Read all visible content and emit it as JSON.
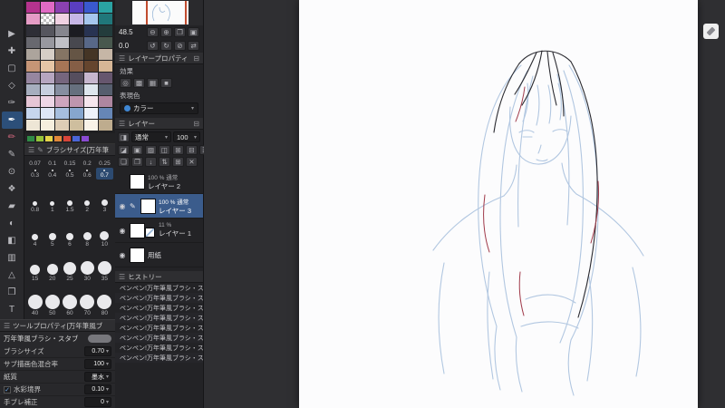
{
  "icons": {
    "menu": "☰",
    "collapse": "⊟",
    "pen": "✎",
    "eye": "◉",
    "check": "✓",
    "dropdown": "▾"
  },
  "toolbar": {
    "tools": [
      {
        "name": "operate-tool",
        "glyph": "▶"
      },
      {
        "name": "move-layer-tool",
        "glyph": "✚"
      },
      {
        "name": "selection-tool",
        "glyph": "▢"
      },
      {
        "name": "auto-select-tool",
        "glyph": "◇"
      },
      {
        "name": "eyedropper-tool",
        "glyph": "✑"
      },
      {
        "name": "pen-tool",
        "glyph": "✒",
        "selected": true
      },
      {
        "name": "pencil-tool",
        "glyph": "✏",
        "accent": true
      },
      {
        "name": "brush-tool",
        "glyph": "✎"
      },
      {
        "name": "airbrush-tool",
        "glyph": "⊙"
      },
      {
        "name": "decoration-tool",
        "glyph": "❖"
      },
      {
        "name": "eraser-tool",
        "glyph": "▰"
      },
      {
        "name": "blend-tool",
        "glyph": "◐"
      },
      {
        "name": "fill-tool",
        "glyph": "◧"
      },
      {
        "name": "gradient-tool",
        "glyph": "▥"
      },
      {
        "name": "figure-tool",
        "glyph": "△"
      },
      {
        "name": "frame-border-tool",
        "glyph": "❒"
      },
      {
        "name": "text-tool",
        "glyph": "T"
      }
    ]
  },
  "palette": {
    "colors": [
      "#b5338e",
      "#e06ac4",
      "#8a41b0",
      "#5a3ec0",
      "#3a59cf",
      "#2aa3a3",
      "#e59cc6",
      "checker",
      "#f0d2e2",
      "#c6b6e6",
      "#a5c6ee",
      "#20777a",
      "#2e2e36",
      "#56565e",
      "#86868e",
      "#1c1c22",
      "#283352",
      "#233c3c",
      "#68686f",
      "#98989f",
      "#c0c0c6",
      "#48484f",
      "#586888",
      "#48584e",
      "#aca49c",
      "#d6cec6",
      "#857564",
      "#655545",
      "#453525",
      "#c6b6a6",
      "#c69576",
      "#e6c6a6",
      "#a67556",
      "#855e46",
      "#65452e",
      "#d6b696",
      "#9686a0",
      "#b6a6c0",
      "#76667e",
      "#564e5e",
      "#c6b6ce",
      "#66566e",
      "#a6aebe",
      "#c6cede",
      "#868ea0",
      "#66707e",
      "#dee6ee",
      "#565e6e",
      "#e6c6d6",
      "#eed6e6",
      "#cea6be",
      "#be96ae",
      "#f6e6ee",
      "#ae86a0",
      "#c6d6ee",
      "#dee6f6",
      "#a6bede",
      "#86a6ce",
      "#eef2fa",
      "#6686b6",
      "#eee6d6",
      "#f6eede",
      "#decdb6",
      "#cebe9e",
      "#f8f3e8",
      "#beac8e"
    ],
    "chips": [
      "#2f8a46",
      "#96c43a",
      "#e6d44a",
      "#e2883a",
      "#d8453a",
      "#4a66d8",
      "#8a4ad2"
    ]
  },
  "brush_panel": {
    "title": "ブラシサイズ[万年筆",
    "selected": "0.7",
    "rows": [
      [
        "0.07",
        "0.1",
        "0.15",
        "0.2",
        "0.25"
      ],
      [
        "0.3",
        "0.4",
        "0.5",
        "0.6",
        "0.7"
      ],
      [
        "0.8",
        "1",
        "1.5",
        "2",
        "3"
      ],
      [
        "4",
        "5",
        "6",
        "8",
        "10"
      ],
      [
        "15",
        "20",
        "25",
        "30",
        "35"
      ],
      [
        "40",
        "50",
        "60",
        "70",
        "80"
      ]
    ]
  },
  "navigator": {
    "zoom": "48.5",
    "rotation": "0.0",
    "zoom_icons": [
      {
        "name": "zoom-out-icon",
        "glyph": "⊖"
      },
      {
        "name": "zoom-in-icon",
        "glyph": "⊕"
      },
      {
        "name": "fit-to-screen-icon",
        "glyph": "❐"
      },
      {
        "name": "actual-size-icon",
        "glyph": "▣"
      }
    ],
    "rotate_icons": [
      {
        "name": "rotate-left-icon",
        "glyph": "↺"
      },
      {
        "name": "rotate-right-icon",
        "glyph": "↻"
      },
      {
        "name": "reset-rotation-icon",
        "glyph": "⊘"
      },
      {
        "name": "flip-horizontal-icon",
        "glyph": "⇄"
      }
    ]
  },
  "layer_property": {
    "title": "レイヤープロパティ",
    "effect_label": "効果",
    "effect_icons": [
      {
        "name": "border-effect-icon",
        "glyph": "◎"
      },
      {
        "name": "tone-effect-icon",
        "glyph": "▩"
      },
      {
        "name": "extract-line-icon",
        "glyph": "▦"
      },
      {
        "name": "layer-color-icon",
        "glyph": "■"
      }
    ],
    "expression_label": "表現色",
    "color_mode": "カラー"
  },
  "layer_panel": {
    "title": "レイヤー",
    "blend_mode": "通常",
    "opacity": "100",
    "icon_row_a": [
      {
        "name": "clip-to-layer-icon",
        "glyph": "◪"
      },
      {
        "name": "lock-layer-icon",
        "glyph": "▣"
      },
      {
        "name": "lock-alpha-icon",
        "glyph": "▨"
      },
      {
        "name": "mask-icon",
        "glyph": "◫"
      },
      {
        "name": "ruler-icon",
        "glyph": "⊞"
      },
      {
        "name": "layer-settings-icon",
        "glyph": "⊟"
      },
      {
        "name": "panel-menu-icon",
        "glyph": "☰"
      }
    ],
    "icon_row_b": [
      {
        "name": "new-layer-icon",
        "glyph": "❏"
      },
      {
        "name": "new-folder-icon",
        "glyph": "❐"
      },
      {
        "name": "transfer-down-icon",
        "glyph": "↓"
      },
      {
        "name": "merge-down-icon",
        "glyph": "⇅"
      },
      {
        "name": "duplicate-layer-icon",
        "glyph": "⊞"
      },
      {
        "name": "delete-layer-icon",
        "glyph": "✕"
      }
    ],
    "layers": [
      {
        "eye": false,
        "pen": false,
        "thumb": "checker",
        "opacity": "100 % 通常",
        "name": "レイヤー 2",
        "selected": false
      },
      {
        "eye": true,
        "pen": true,
        "thumb": "checker-tint",
        "opacity": "100 % 通常",
        "name": "レイヤー 3",
        "selected": true
      },
      {
        "eye": true,
        "pen": false,
        "thumb": "double",
        "opacity": "11 %",
        "name": "レイヤー 1",
        "selected": false
      },
      {
        "eye": true,
        "pen": false,
        "thumb": "white",
        "opacity": "",
        "name": "用紙",
        "selected": false
      }
    ]
  },
  "history_panel": {
    "title": "ヒストリー",
    "entries": [
      "ペンペン!万年筆風ブラシ・スタブ",
      "ペンペン!万年筆風ブラシ・スタブ",
      "ペンペン!万年筆風ブラシ・スタブ",
      "ペンペン!万年筆風ブラシ・スタブ",
      "ペンペン!万年筆風ブラシ・スタブ",
      "ペンペン!万年筆風ブラシ・スタブ",
      "ペンペン!万年筆風ブラシ・スタブ",
      "ペンペン!万年筆風ブラシ・スタブ"
    ]
  },
  "tool_property": {
    "title": "ツールプロパティ[万年筆風ブ",
    "subtool": "万年筆風ブラシ・スタブ",
    "fields": [
      {
        "label": "ブラシサイズ",
        "value": "0.70"
      },
      {
        "label": "サブ描画色混合率",
        "value": "100"
      },
      {
        "label": "紙質",
        "value": "墨水"
      },
      {
        "label": "水彩境界",
        "value": "0.10",
        "checkbox": true,
        "checked": true
      },
      {
        "label": "手ブレ補正",
        "value": "0"
      }
    ]
  }
}
